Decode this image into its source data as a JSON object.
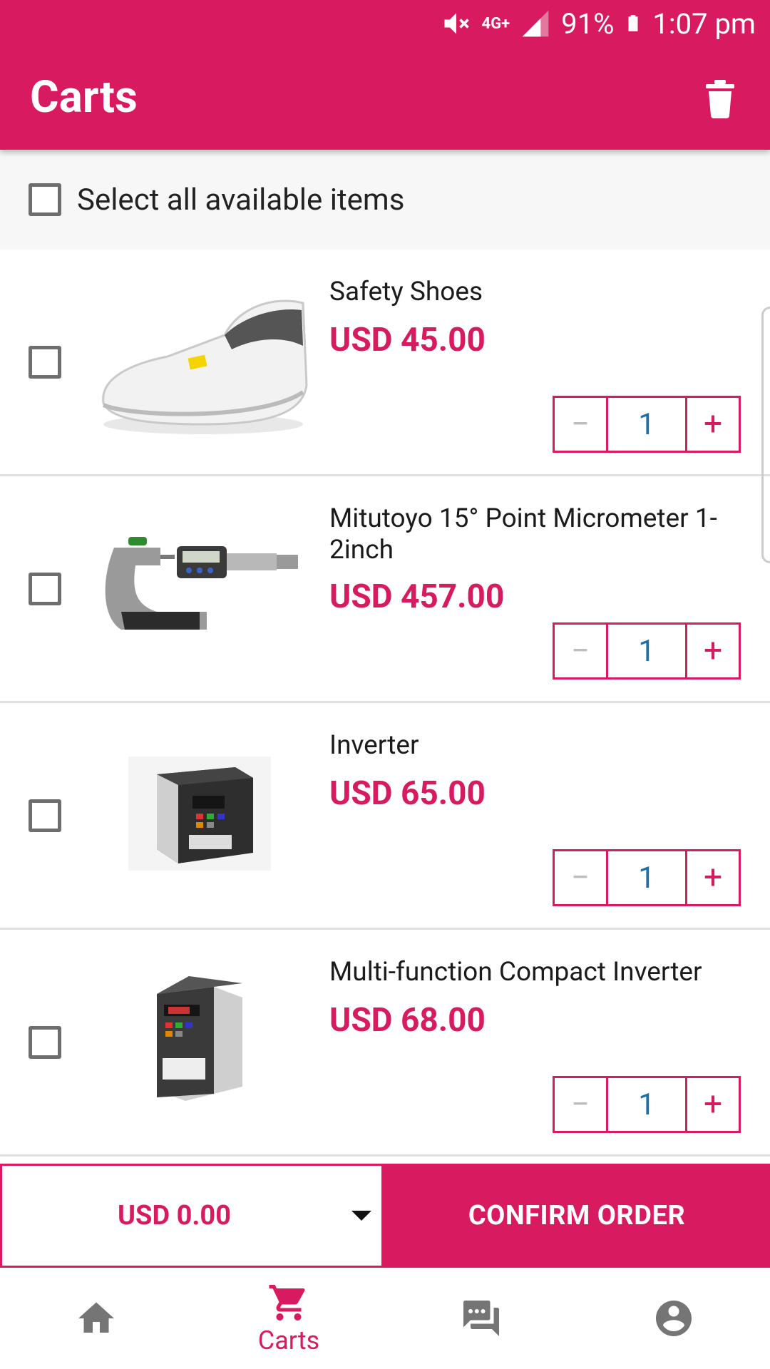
{
  "status_bar": {
    "battery": "91%",
    "time": "1:07 pm",
    "network": "4G+"
  },
  "header": {
    "title": "Carts"
  },
  "select_all": {
    "label": "Select all available items"
  },
  "items": [
    {
      "name": "Safety Shoes",
      "price": "USD 45.00",
      "qty": "1",
      "thumb": "safety-shoe"
    },
    {
      "name": "Mitutoyo 15° Point Micrometer 1-2inch",
      "price": "USD 457.00",
      "qty": "1",
      "thumb": "micrometer"
    },
    {
      "name": "Inverter",
      "price": "USD 65.00",
      "qty": "1",
      "thumb": "inverter"
    },
    {
      "name": "Multi-function Compact Inverter",
      "price": "USD 68.00",
      "qty": "1",
      "thumb": "compact-inverter"
    }
  ],
  "stepper": {
    "minus": "−",
    "plus": "+"
  },
  "order_bar": {
    "total": "USD 0.00",
    "confirm_label": "CONFIRM ORDER"
  },
  "bottom_nav": [
    {
      "icon": "home-icon",
      "label": ""
    },
    {
      "icon": "cart-icon",
      "label": "Carts"
    },
    {
      "icon": "chat-icon",
      "label": ""
    },
    {
      "icon": "account-icon",
      "label": ""
    }
  ],
  "colors": {
    "accent": "#d81b60",
    "qty_text": "#1e6fa8",
    "muted": "#bdbdbd",
    "nav_icon": "#757575"
  }
}
